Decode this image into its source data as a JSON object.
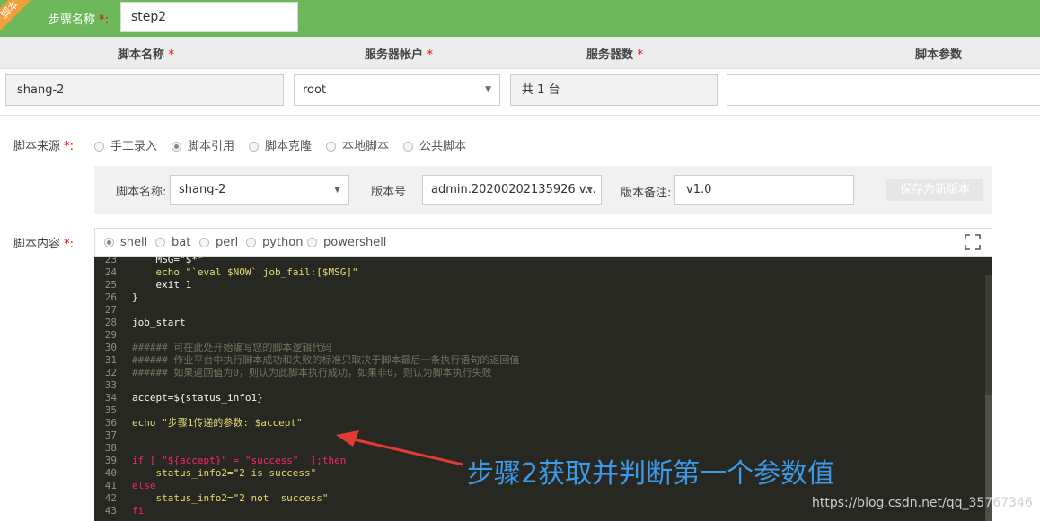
{
  "step": {
    "ribbon": "脚本",
    "name_label": "步骤名称",
    "required_mark": "*:",
    "name_value": "step2"
  },
  "table_header": {
    "script_name": "脚本名称",
    "account": "服务器帐户",
    "server_count": "服务器数",
    "params": "脚本参数",
    "req": "*"
  },
  "row": {
    "script_name": "shang-2",
    "account": "root",
    "server_count": "共 1 台",
    "params": ""
  },
  "source": {
    "label": "脚本来源",
    "req": "*:",
    "options": [
      "手工录入",
      "脚本引用",
      "脚本克隆",
      "本地脚本",
      "公共脚本"
    ],
    "selected": "脚本引用"
  },
  "ref": {
    "name_label": "脚本名称:",
    "name_value": "shang-2",
    "version_label": "版本号",
    "version_value": "admin.20200202135926 v...",
    "remark_label": "版本备注:",
    "remark_value": "v1.0",
    "save_button": "保存为新版本"
  },
  "content": {
    "label": "脚本内容",
    "req": "*:",
    "languages": [
      "shell",
      "bat",
      "perl",
      "python",
      "powershell"
    ],
    "selected_language": "shell"
  },
  "editor_lines": [
    {
      "n": "23",
      "t": "    MSG=\"$*\""
    },
    {
      "n": "24",
      "t": "    echo \"`eval $NOW` job_fail:[$MSG]\""
    },
    {
      "n": "25",
      "t": "    exit 1"
    },
    {
      "n": "26",
      "t": "}"
    },
    {
      "n": "27",
      "t": ""
    },
    {
      "n": "28",
      "t": "job_start"
    },
    {
      "n": "29",
      "t": ""
    },
    {
      "n": "30",
      "t": "###### 可在此处开始编写您的脚本逻辑代码"
    },
    {
      "n": "31",
      "t": "###### 作业平台中执行脚本成功和失败的标准只取决于脚本最后一条执行语句的返回值"
    },
    {
      "n": "32",
      "t": "###### 如果返回值为0，则认为此脚本执行成功，如果非0，则认为脚本执行失败"
    },
    {
      "n": "33",
      "t": ""
    },
    {
      "n": "34",
      "t": "accept=${status_info1}"
    },
    {
      "n": "35",
      "t": ""
    },
    {
      "n": "36",
      "t": "echo \"步骤1传递的参数: $accept\""
    },
    {
      "n": "37",
      "t": ""
    },
    {
      "n": "38",
      "t": ""
    },
    {
      "n": "39",
      "t": "if [ \"${accept}\" = \"success\"  ];then"
    },
    {
      "n": "40",
      "t": "    status_info2=\"2 is success\""
    },
    {
      "n": "41",
      "t": "else"
    },
    {
      "n": "42",
      "t": "    status_info2=\"2 not  success\""
    },
    {
      "n": "43",
      "t": "fi"
    }
  ],
  "annotation": "步骤2获取并判断第一个参数值",
  "watermark": "https://blog.csdn.net/qq_35767346",
  "colors": {
    "step_bar": "#6cb85a",
    "editor_bg": "#272822",
    "annotation": "#3d9ae8",
    "arrow": "#e53935"
  }
}
